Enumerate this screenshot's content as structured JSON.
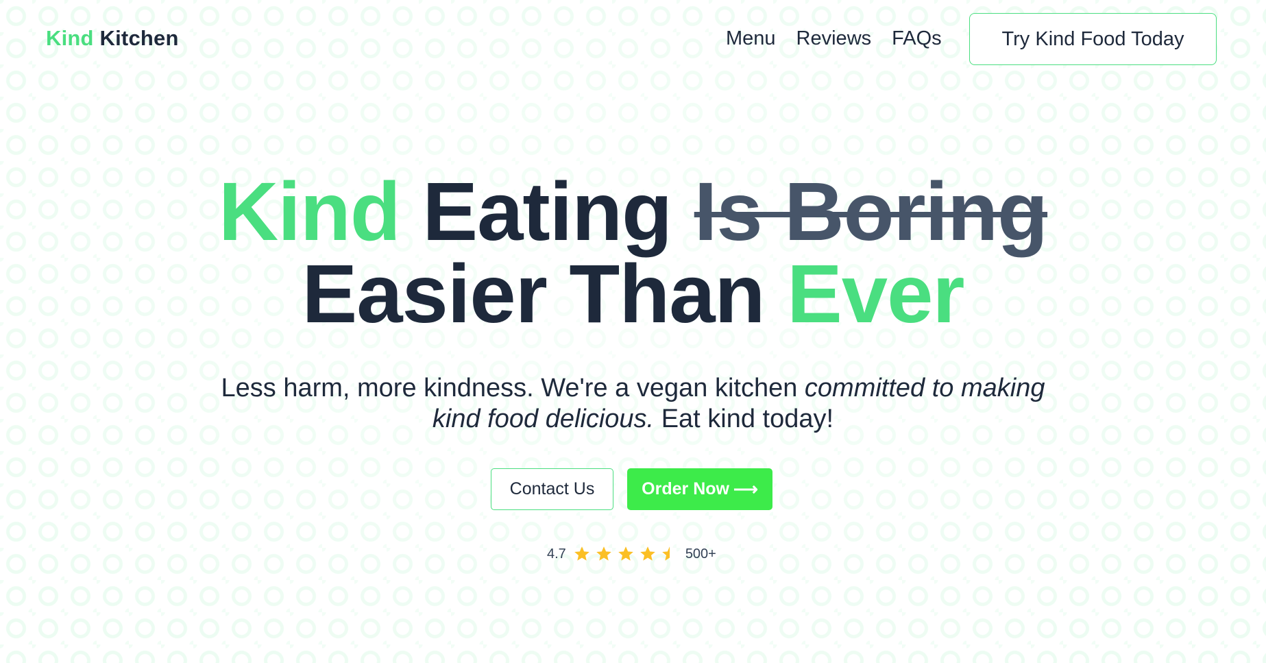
{
  "brand": {
    "name_part_1": "Kind",
    "name_part_2": "Kitchen"
  },
  "nav": {
    "items": [
      {
        "label": "Menu"
      },
      {
        "label": "Reviews"
      },
      {
        "label": "FAQs"
      }
    ],
    "cta_label": "Try Kind Food Today"
  },
  "hero": {
    "line1_green": "Kind",
    "line1_dark": "Eating",
    "line1_strike": "Is Boring",
    "line2_dark": "Easier Than",
    "line2_green": "Ever",
    "subtitle_plain_1": "Less harm, more kindness. We're a vegan kitchen",
    "subtitle_italic": "committed to making kind food delicious.",
    "subtitle_plain_2": "Eat kind today!"
  },
  "actions": {
    "contact_label": "Contact Us",
    "order_label": "Order Now",
    "order_arrow": "⟶"
  },
  "rating": {
    "score": "4.7",
    "count": "500+",
    "stars_filled": 4.5,
    "stars_total": 5
  },
  "colors": {
    "accent_green": "#4ade80",
    "button_green": "#3deb4a",
    "text_dark": "#1e293b",
    "strike_gray": "#475569",
    "star_yellow": "#fbbf24"
  }
}
